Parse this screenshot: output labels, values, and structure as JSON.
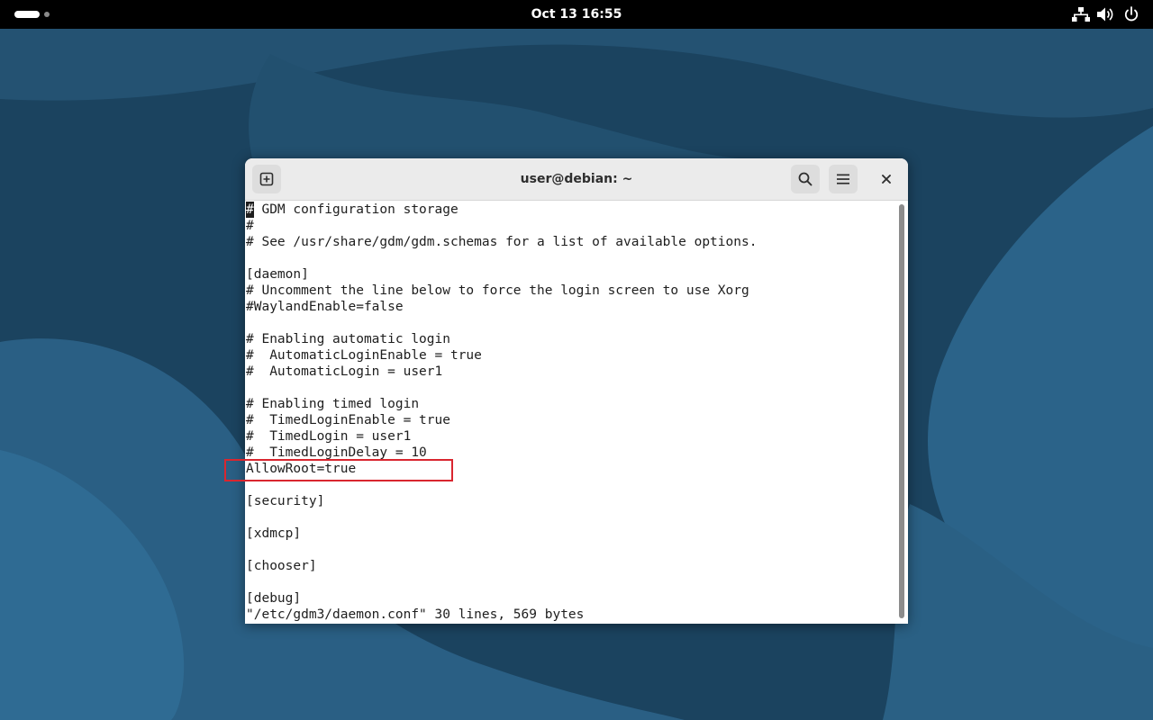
{
  "topbar": {
    "clock": "Oct 13  16:55",
    "activities_icon": "workspace-indicator-icon",
    "tray_icons": [
      "network-wired-icon",
      "volume-icon",
      "power-icon"
    ]
  },
  "window": {
    "title": "user@debian: ~",
    "new_tab_icon": "new-tab-icon",
    "search_icon": "search-icon",
    "menu_icon": "hamburger-menu-icon",
    "close_icon": "close-icon"
  },
  "terminal": {
    "cursor_char": "#",
    "lines": [
      " GDM configuration storage",
      "#",
      "# See /usr/share/gdm/gdm.schemas for a list of available options.",
      "",
      "[daemon]",
      "# Uncomment the line below to force the login screen to use Xorg",
      "#WaylandEnable=false",
      "",
      "# Enabling automatic login",
      "#  AutomaticLoginEnable = true",
      "#  AutomaticLogin = user1",
      "",
      "# Enabling timed login",
      "#  TimedLoginEnable = true",
      "#  TimedLogin = user1",
      "#  TimedLoginDelay = 10",
      "AllowRoot=true",
      "",
      "[security]",
      "",
      "[xdmcp]",
      "",
      "[chooser]",
      "",
      "[debug]"
    ],
    "status_line": "\"/etc/gdm3/daemon.conf\" 30 lines, 569 bytes"
  },
  "colors": {
    "desktop_bg": "#1f4a6a",
    "topbar_bg": "#000000",
    "headerbar_bg": "#ebebeb",
    "highlight": "#d9262f"
  }
}
